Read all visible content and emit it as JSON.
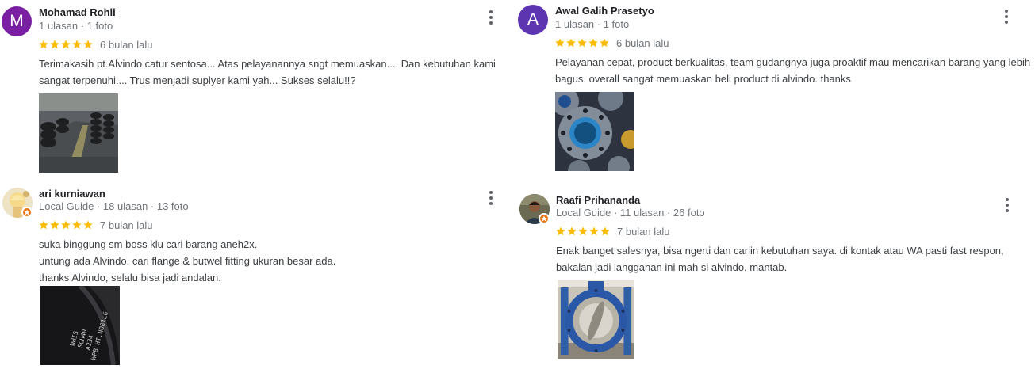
{
  "reviews": [
    {
      "name": "Mohamad Rohli",
      "avatar_letter": "M",
      "avatar_color": "#7b1fa2",
      "meta": "1 ulasan · 1 foto",
      "rating": 5,
      "when": "6 bulan lalu",
      "lines": [
        "Terimakasih pt.Alvindo catur sentosa...  Atas pelayanannya sngt memuaskan....  Dan kebutuhan kami",
        "sangat terpenuhi.... Trus menjadi suplyer kami yah...  Sukses selalu!!?"
      ]
    },
    {
      "name": "Awal Galih Prasetyo",
      "avatar_letter": "A",
      "avatar_color": "#5e35b1",
      "meta": "1 ulasan · 1 foto",
      "rating": 5,
      "when": "6 bulan lalu",
      "lines": [
        "Pelayanan cepat, product berkualitas, team gudangnya juga proaktif mau mencarikan barang yang lebih",
        "bagus. overall sangat memuaskan beli product di alvindo. thanks"
      ]
    },
    {
      "name": "ari kurniawan",
      "meta": "Local Guide · 18 ulasan · 13 foto",
      "rating": 5,
      "when": "7 bulan lalu",
      "lines": [
        "suka binggung sm boss klu cari barang aneh2x.",
        "untung ada Alvindo, cari flange & butwel fitting ukuran besar ada.",
        "thanks Alvindo, selalu bisa jadi andalan."
      ],
      "photo_text": [
        "WHIS",
        "SCH40",
        "A234",
        "WPB HT.NO81L6"
      ]
    },
    {
      "name": "Raafi Prihananda",
      "meta": "Local Guide · 11 ulasan · 26 foto",
      "rating": 5,
      "when": "7 bulan lalu",
      "lines": [
        "Enak banget salesnya, bisa ngerti dan cariin kebutuhan saya. di kontak atau WA pasti fast respon,",
        "bakalan jadi langganan ini mah si alvindo. mantab."
      ]
    }
  ],
  "colors": {
    "star": "#fbbc04",
    "guide_badge": "#e8710a"
  }
}
